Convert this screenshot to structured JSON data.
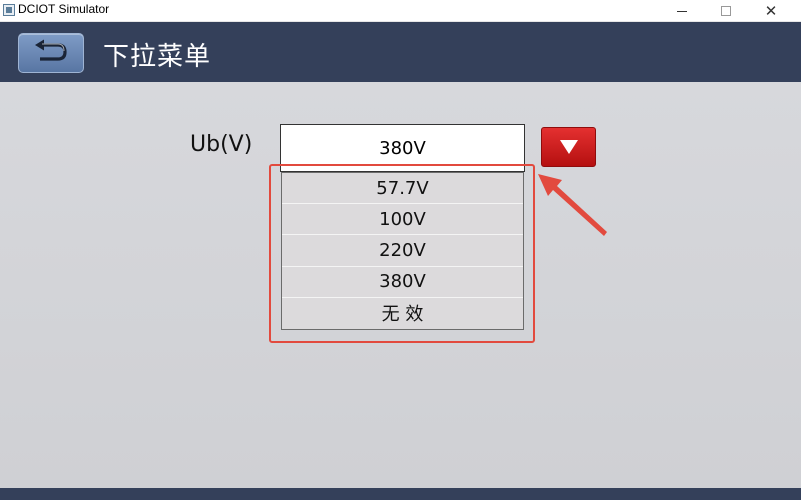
{
  "window": {
    "title": "DCIOT Simulator",
    "minimize_glyph": "",
    "maximize_glyph": "",
    "close_glyph": "✕"
  },
  "header": {
    "title": "下拉菜单",
    "back_icon": "back-arrow-icon"
  },
  "form": {
    "label": "Ub(V)",
    "selected_value": "380V",
    "dropdown_icon": "triangle-down-icon",
    "options": [
      "57.7V",
      "100V",
      "220V",
      "380V",
      "无 效"
    ]
  },
  "colors": {
    "header_bg": "#34405a",
    "content_bg": "#d4d5d9",
    "dropdown_button": "#d42020",
    "annotation": "#e24a3e"
  }
}
